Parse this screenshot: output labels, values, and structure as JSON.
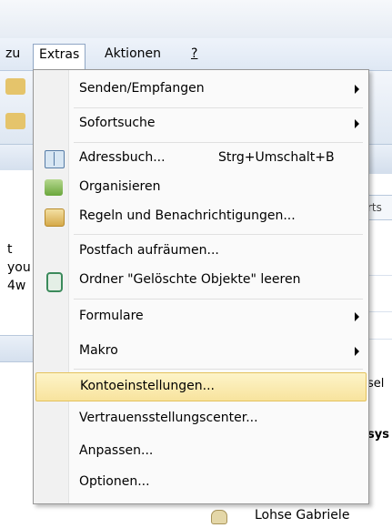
{
  "menubar": {
    "partial_item": "zu",
    "extras": "Extras",
    "aktionen": "Aktionen",
    "help": "?"
  },
  "left_pane": {
    "text_lines": [
      "t",
      "you",
      "4w"
    ]
  },
  "right_pane": {
    "tab_text": "rts",
    "row_text_1": "sel",
    "row_text_2": "sys",
    "contact_name": "Lohse Gabriele"
  },
  "extras_menu": {
    "items": [
      {
        "label": "Senden/Empfangen",
        "submenu": true
      },
      {
        "label": "Sofortsuche",
        "submenu": true
      },
      {
        "label": "Adressbuch...",
        "shortcut": "Strg+Umschalt+B",
        "icon": "address-book-icon"
      },
      {
        "label": "Organisieren",
        "icon": "organize-icon"
      },
      {
        "label": "Regeln und Benachrichtigungen...",
        "icon": "rules-icon"
      },
      {
        "label": "Postfach aufräumen..."
      },
      {
        "label": "Ordner \"Gelöschte Objekte\" leeren",
        "icon": "empty-trash-icon"
      },
      {
        "label": "Formulare",
        "submenu": true
      },
      {
        "label": "Makro",
        "submenu": true
      },
      {
        "label": "Kontoeinstellungen...",
        "highlighted": true
      },
      {
        "label": "Vertrauensstellungscenter..."
      },
      {
        "label": "Anpassen..."
      },
      {
        "label": "Optionen..."
      }
    ]
  },
  "colors": {
    "highlight": "#f8e39d",
    "menu_bg": "#fafafa",
    "menubar_bg": "#dfe8f4"
  }
}
